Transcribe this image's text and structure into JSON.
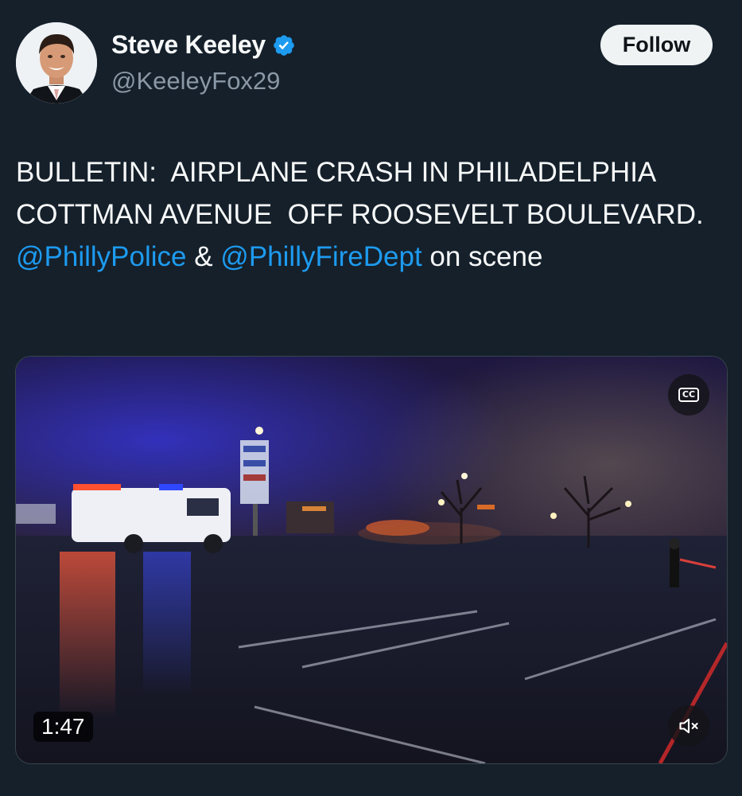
{
  "author": {
    "display_name": "Steve Keeley",
    "handle": "@KeeleyFox29",
    "verified_icon": "verified-badge-icon",
    "avatar_icon": "avatar-photo"
  },
  "follow_button": {
    "label": "Follow"
  },
  "tweet": {
    "text_part1": "BULLETIN:  AIRPLANE CRASH IN PHILADELPHIA COTTMAN AVENUE  OFF ROOSEVELT BOULEVARD.  ",
    "mention1": "@PhillyPolice",
    "text_part2": " & ",
    "mention2": "@PhillyFireDept",
    "text_part3": " on scene"
  },
  "video": {
    "duration": "1:47",
    "cc_label": "CC",
    "cc_icon": "closed-captions-icon",
    "mute_icon": "muted-speaker-icon"
  },
  "colors": {
    "background": "#15202b",
    "link": "#1d9bf0",
    "verified": "#1d9bf0",
    "handle": "#8b98a5"
  }
}
